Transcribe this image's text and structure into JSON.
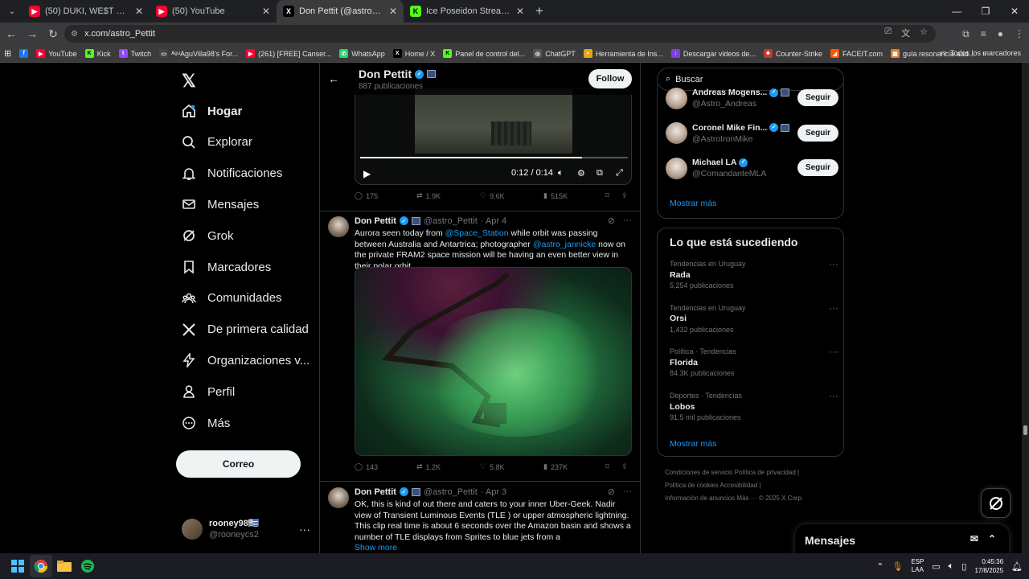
{
  "browser": {
    "tabs": [
      {
        "title": "(50) DUKI, WE$T DUBAI - cONT",
        "favicon": "youtube",
        "color": "#ff0033",
        "glyph": "▶"
      },
      {
        "title": "(50) YouTube",
        "favicon": "youtube",
        "color": "#ff0033",
        "glyph": "▶"
      },
      {
        "title": "Don Pettit (@astro_Pettit) / X",
        "favicon": "x",
        "color": "#000000",
        "glyph": "X"
      },
      {
        "title": "Ice Poseidon Stream - Watch Li",
        "favicon": "kick",
        "color": "#53fc18",
        "glyph": "K"
      }
    ],
    "url": "x.com/astro_Pettit",
    "bookmarks": [
      {
        "label": "",
        "color": "#1877f2",
        "glyph": "f"
      },
      {
        "label": "YouTube",
        "color": "#ff0033",
        "glyph": "▶"
      },
      {
        "label": "Kick",
        "color": "#53fc18",
        "glyph": "K"
      },
      {
        "label": "Twitch",
        "color": "#9146ff",
        "glyph": "t"
      },
      {
        "label": "ᴬᵍᵘAguVilla98's For...",
        "color": "#444444",
        "glyph": "▭"
      },
      {
        "label": "(261) [FREE] Canser...",
        "color": "#ff0033",
        "glyph": "▶"
      },
      {
        "label": "WhatsApp",
        "color": "#25d366",
        "glyph": "✆"
      },
      {
        "label": "Home / X",
        "color": "#000000",
        "glyph": "X"
      },
      {
        "label": "Panel de control del...",
        "color": "#53fc18",
        "glyph": "K"
      },
      {
        "label": "ChatGPT",
        "color": "#555555",
        "glyph": "◎"
      },
      {
        "label": "Herramienta de Ins...",
        "color": "#e8a317",
        "glyph": "⌕"
      },
      {
        "label": "Descargar videos de...",
        "color": "#7b3fe4",
        "glyph": "↓"
      },
      {
        "label": "Counter-Strike",
        "color": "#c0392b",
        "glyph": "☻"
      },
      {
        "label": "FACEIT.com",
        "color": "#ff5500",
        "glyph": "◢"
      },
      {
        "label": "guía resonancia aud...",
        "color": "#e67e22",
        "glyph": "▦"
      }
    ],
    "bookmarks_more": "»",
    "all_bookmarks": "Todos los marcadores"
  },
  "nav": {
    "items": [
      {
        "label": "Hogar",
        "icon": "home-icon"
      },
      {
        "label": "Explorar",
        "icon": "search-icon"
      },
      {
        "label": "Notificaciones",
        "icon": "bell-icon"
      },
      {
        "label": "Mensajes",
        "icon": "mail-icon"
      },
      {
        "label": "Grok",
        "icon": "grok-icon"
      },
      {
        "label": "Marcadores",
        "icon": "bookmark-icon"
      },
      {
        "label": "Comunidades",
        "icon": "communities-icon"
      },
      {
        "label": "De primera calidad",
        "icon": "x-logo-icon"
      },
      {
        "label": "Organizaciones v...",
        "icon": "lightning-icon"
      },
      {
        "label": "Perfil",
        "icon": "person-icon"
      },
      {
        "label": "Más",
        "icon": "more-circle-icon"
      }
    ],
    "post_button": "Correo",
    "account": {
      "name": "rooney98🇺🇾",
      "handle": "@rooneycs2"
    }
  },
  "profile": {
    "name": "Don Pettit",
    "posts_count": "887 publicaciones",
    "follow_label": "Follow"
  },
  "video": {
    "time": "0:12 / 0:14",
    "progress": 0.83
  },
  "tweets": [
    {
      "replies": "175",
      "retweets": "1.9K",
      "likes": "9.6K",
      "views": "515K"
    },
    {
      "name": "Don Pettit",
      "handle": "@astro_Pettit",
      "date": "· Apr 4",
      "text_parts": [
        {
          "t": "Aurora seen today from "
        },
        {
          "t": "@Space_Station",
          "link": true
        },
        {
          "t": " while orbit was passing between Australia and Antartrica; photographer "
        },
        {
          "t": "@astro_jannicke",
          "link": true
        },
        {
          "t": " now on the private FRAM2 space mission will be having an even better view in their polar orbit."
        }
      ],
      "replies": "143",
      "retweets": "1.2K",
      "likes": "5.8K",
      "views": "237K"
    },
    {
      "name": "Don Pettit",
      "handle": "@astro_Pettit",
      "date": "· Apr 3",
      "text": "OK, this is kind of out there and caters to your inner Uber-Geek.  Nadir view of Transient Luminous Events (TLE ) or upper atmospheric lightning. This clip real time is about 6 seconds over the Amazon basin and shows a number of TLE displays from Sprites to blue jets from a",
      "show_more": "Show more"
    }
  ],
  "search": {
    "placeholder": "Buscar"
  },
  "who_to_follow": [
    {
      "name": "Andreas Mogens...",
      "handle": "@Astro_Andreas",
      "button": "Seguir"
    },
    {
      "name": "Coronel Mike Fin...",
      "handle": "@AstroIronMike",
      "button": "Seguir"
    },
    {
      "name": "Michael LA",
      "handle": "@ComandanteMLA",
      "button": "Seguir"
    }
  ],
  "show_more_1": "Mostrar más",
  "trends": {
    "title": "Lo que está sucediendo",
    "items": [
      {
        "context": "Tendencias en Uruguay",
        "topic": "Rada",
        "count": "5,254 publicaciones"
      },
      {
        "context": "Tendencias en Uruguay",
        "topic": "Orsi",
        "count": "1,432 publicaciones"
      },
      {
        "context": "Política · Tendencias",
        "topic": "Florida",
        "count": "84.3K publicaciones"
      },
      {
        "context": "Deportes · Tendencias",
        "topic": "Lobos",
        "count": "91.5 mil publicaciones"
      }
    ],
    "show_more": "Mostrar más"
  },
  "footer": {
    "links": [
      "Condiciones de servicio",
      "Política de privacidad",
      "Política de cookies",
      "Accesibilidad",
      "Información de anuncios",
      "Más ···",
      "© 2025 X Corp."
    ]
  },
  "messages_dock": {
    "title": "Mensajes"
  },
  "taskbar": {
    "lang1": "ESP",
    "lang2": "LAA",
    "time": "0:45:36",
    "date": "17/8/2025"
  }
}
